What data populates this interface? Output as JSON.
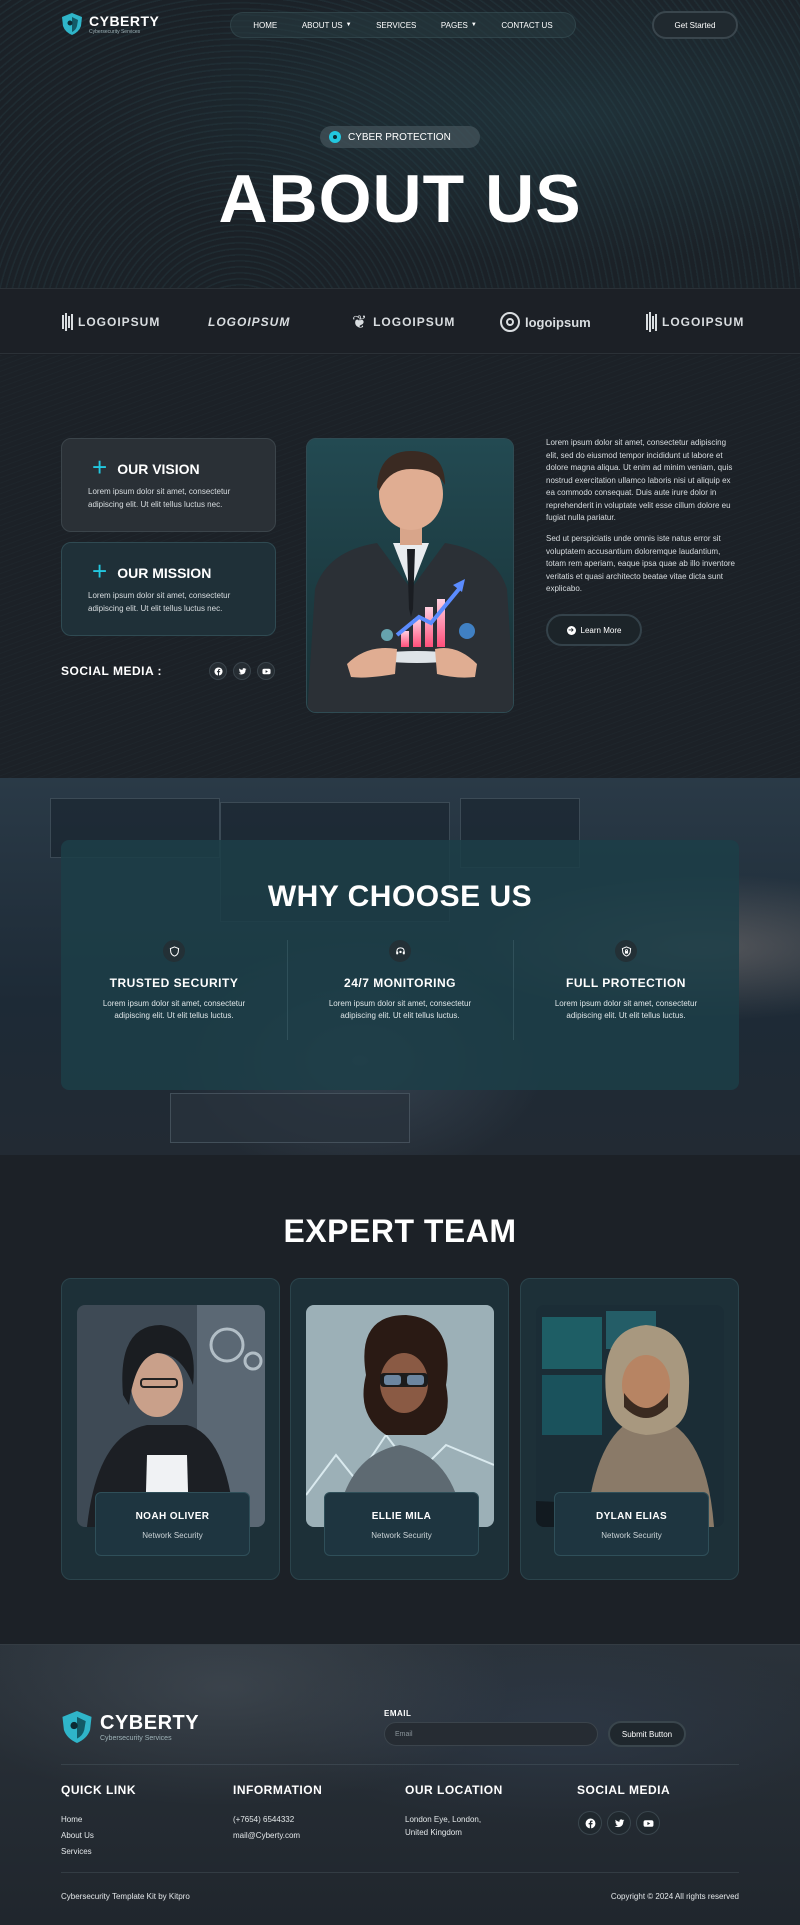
{
  "header": {
    "brand": "CYBERTY",
    "brand_sub": "Cybersecurity Services",
    "nav": [
      "HOME",
      "ABOUT US",
      "SERVICES",
      "PAGES",
      "CONTACT US"
    ],
    "cta": "Get Started"
  },
  "hero": {
    "badge": "CYBER PROTECTION",
    "title": "ABOUT US"
  },
  "logos": [
    "LOGOIPSUM",
    "LOGOIPSUM",
    "LOGOIPSUM",
    "logoipsum",
    "LOGOIPSUM"
  ],
  "about": {
    "vision_title": "OUR VISION",
    "vision_body": "Lorem ipsum dolor sit amet, consectetur adipiscing elit. Ut elit tellus luctus nec.",
    "mission_title": "OUR MISSION",
    "mission_body": "Lorem ipsum dolor sit amet, consectetur adipiscing elit. Ut elit tellus luctus nec.",
    "social_label": "SOCIAL MEDIA :",
    "paragraph1": "Lorem ipsum dolor sit amet, consectetur adipiscing elit, sed do eiusmod tempor incididunt ut labore et dolore magna aliqua. Ut enim ad minim veniam, quis nostrud exercitation ullamco laboris nisi ut aliquip ex ea commodo consequat. Duis aute irure dolor in reprehenderit in voluptate velit esse cillum dolore eu fugiat nulla pariatur.",
    "paragraph2": "Sed ut perspiciatis unde omnis iste natus error sit voluptatem accusantium doloremque laudantium, totam rem aperiam, eaque ipsa quae ab illo inventore veritatis et quasi architecto beatae vitae dicta sunt explicabo.",
    "learn_more": "Learn More"
  },
  "why": {
    "title": "WHY CHOOSE US",
    "features": [
      {
        "title": "TRUSTED SECURITY",
        "body": "Lorem ipsum dolor sit amet, consectetur adipiscing elit. Ut elit tellus luctus.",
        "icon": "shield-icon"
      },
      {
        "title": "24/7 MONITORING",
        "body": "Lorem ipsum dolor sit amet, consectetur adipiscing elit. Ut elit tellus luctus.",
        "icon": "headset-icon"
      },
      {
        "title": "FULL PROTECTION",
        "body": "Lorem ipsum dolor sit amet, consectetur adipiscing elit. Ut elit tellus luctus.",
        "icon": "lock-shield-icon"
      }
    ]
  },
  "team": {
    "title": "EXPERT TEAM",
    "members": [
      {
        "name": "NOAH OLIVER",
        "role": "Network Security"
      },
      {
        "name": "ELLIE MILA",
        "role": "Network Security"
      },
      {
        "name": "DYLAN ELIAS",
        "role": "Network Security"
      }
    ]
  },
  "footer": {
    "brand": "CYBERTY",
    "brand_sub": "Cybersecurity Services",
    "email_label": "EMAIL",
    "email_placeholder": "Email",
    "submit": "Submit Button",
    "quick_link_title": "QUICK LINK",
    "quick_links": [
      "Home",
      "About Us",
      "Services"
    ],
    "info_title": "INFORMATION",
    "phone": "(+7654) 6544332",
    "email": "mail@Cyberty.com",
    "location_title": "OUR LOCATION",
    "location_line1": "London Eye, London,",
    "location_line2": "United Kingdom",
    "social_title": "SOCIAL MEDIA",
    "credit": "Cybersecurity Template Kit by Kitpro",
    "copyright": "Copyright © 2024 All rights reserved"
  },
  "colors": {
    "accent": "#22c7df",
    "bg": "#1b1f25",
    "panel": "#1d3038"
  }
}
